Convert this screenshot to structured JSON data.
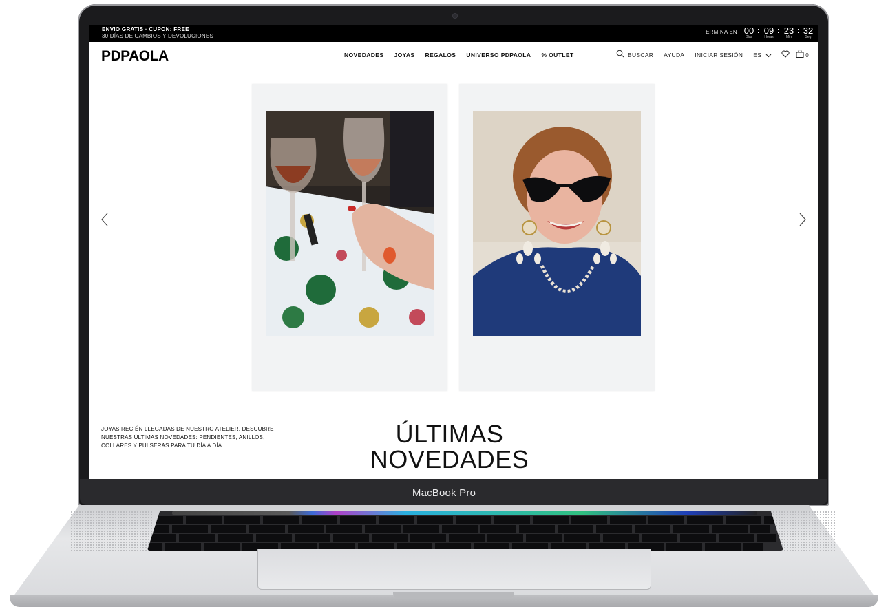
{
  "device": {
    "label": "MacBook Pro"
  },
  "promo": {
    "line1": "ENVIO GRATIS · CUPON: FREE",
    "line2": "30 DÍAS DE CAMBIOS Y DEVOLUCIONES",
    "countdown_label": "TERMINA EN",
    "countdown": [
      {
        "value": "00",
        "caption": "Días"
      },
      {
        "value": "09",
        "caption": "Horas"
      },
      {
        "value": "23",
        "caption": "Min"
      },
      {
        "value": "32",
        "caption": "Seg"
      }
    ]
  },
  "header": {
    "logo": "PDPAOLA",
    "nav": [
      "NOVEDADES",
      "JOYAS",
      "REGALOS",
      "UNIVERSO PDPAOLA",
      "% OUTLET"
    ],
    "search_label": "BUSCAR",
    "help_label": "AYUDA",
    "login_label": "INICIAR SESIÓN",
    "language": "ES",
    "cart_count": "0"
  },
  "hero": {
    "description": "JOYAS RECIÉN LLEGADAS DE NUESTRO ATELIER. DESCUBRE NUESTRAS ÚLTIMAS NOVEDADES: PENDIENTES, ANILLOS, COLLARES Y PULSERAS PARA TU DÍA A DÍA.",
    "title_line1": "ÚLTIMAS",
    "title_line2": "NOVEDADES"
  },
  "icons": {
    "prev": "chevron-left-icon",
    "next": "chevron-right-icon",
    "search": "search-icon",
    "language_dropdown": "chevron-down-icon",
    "wishlist": "heart-icon",
    "cart": "bag-icon"
  }
}
